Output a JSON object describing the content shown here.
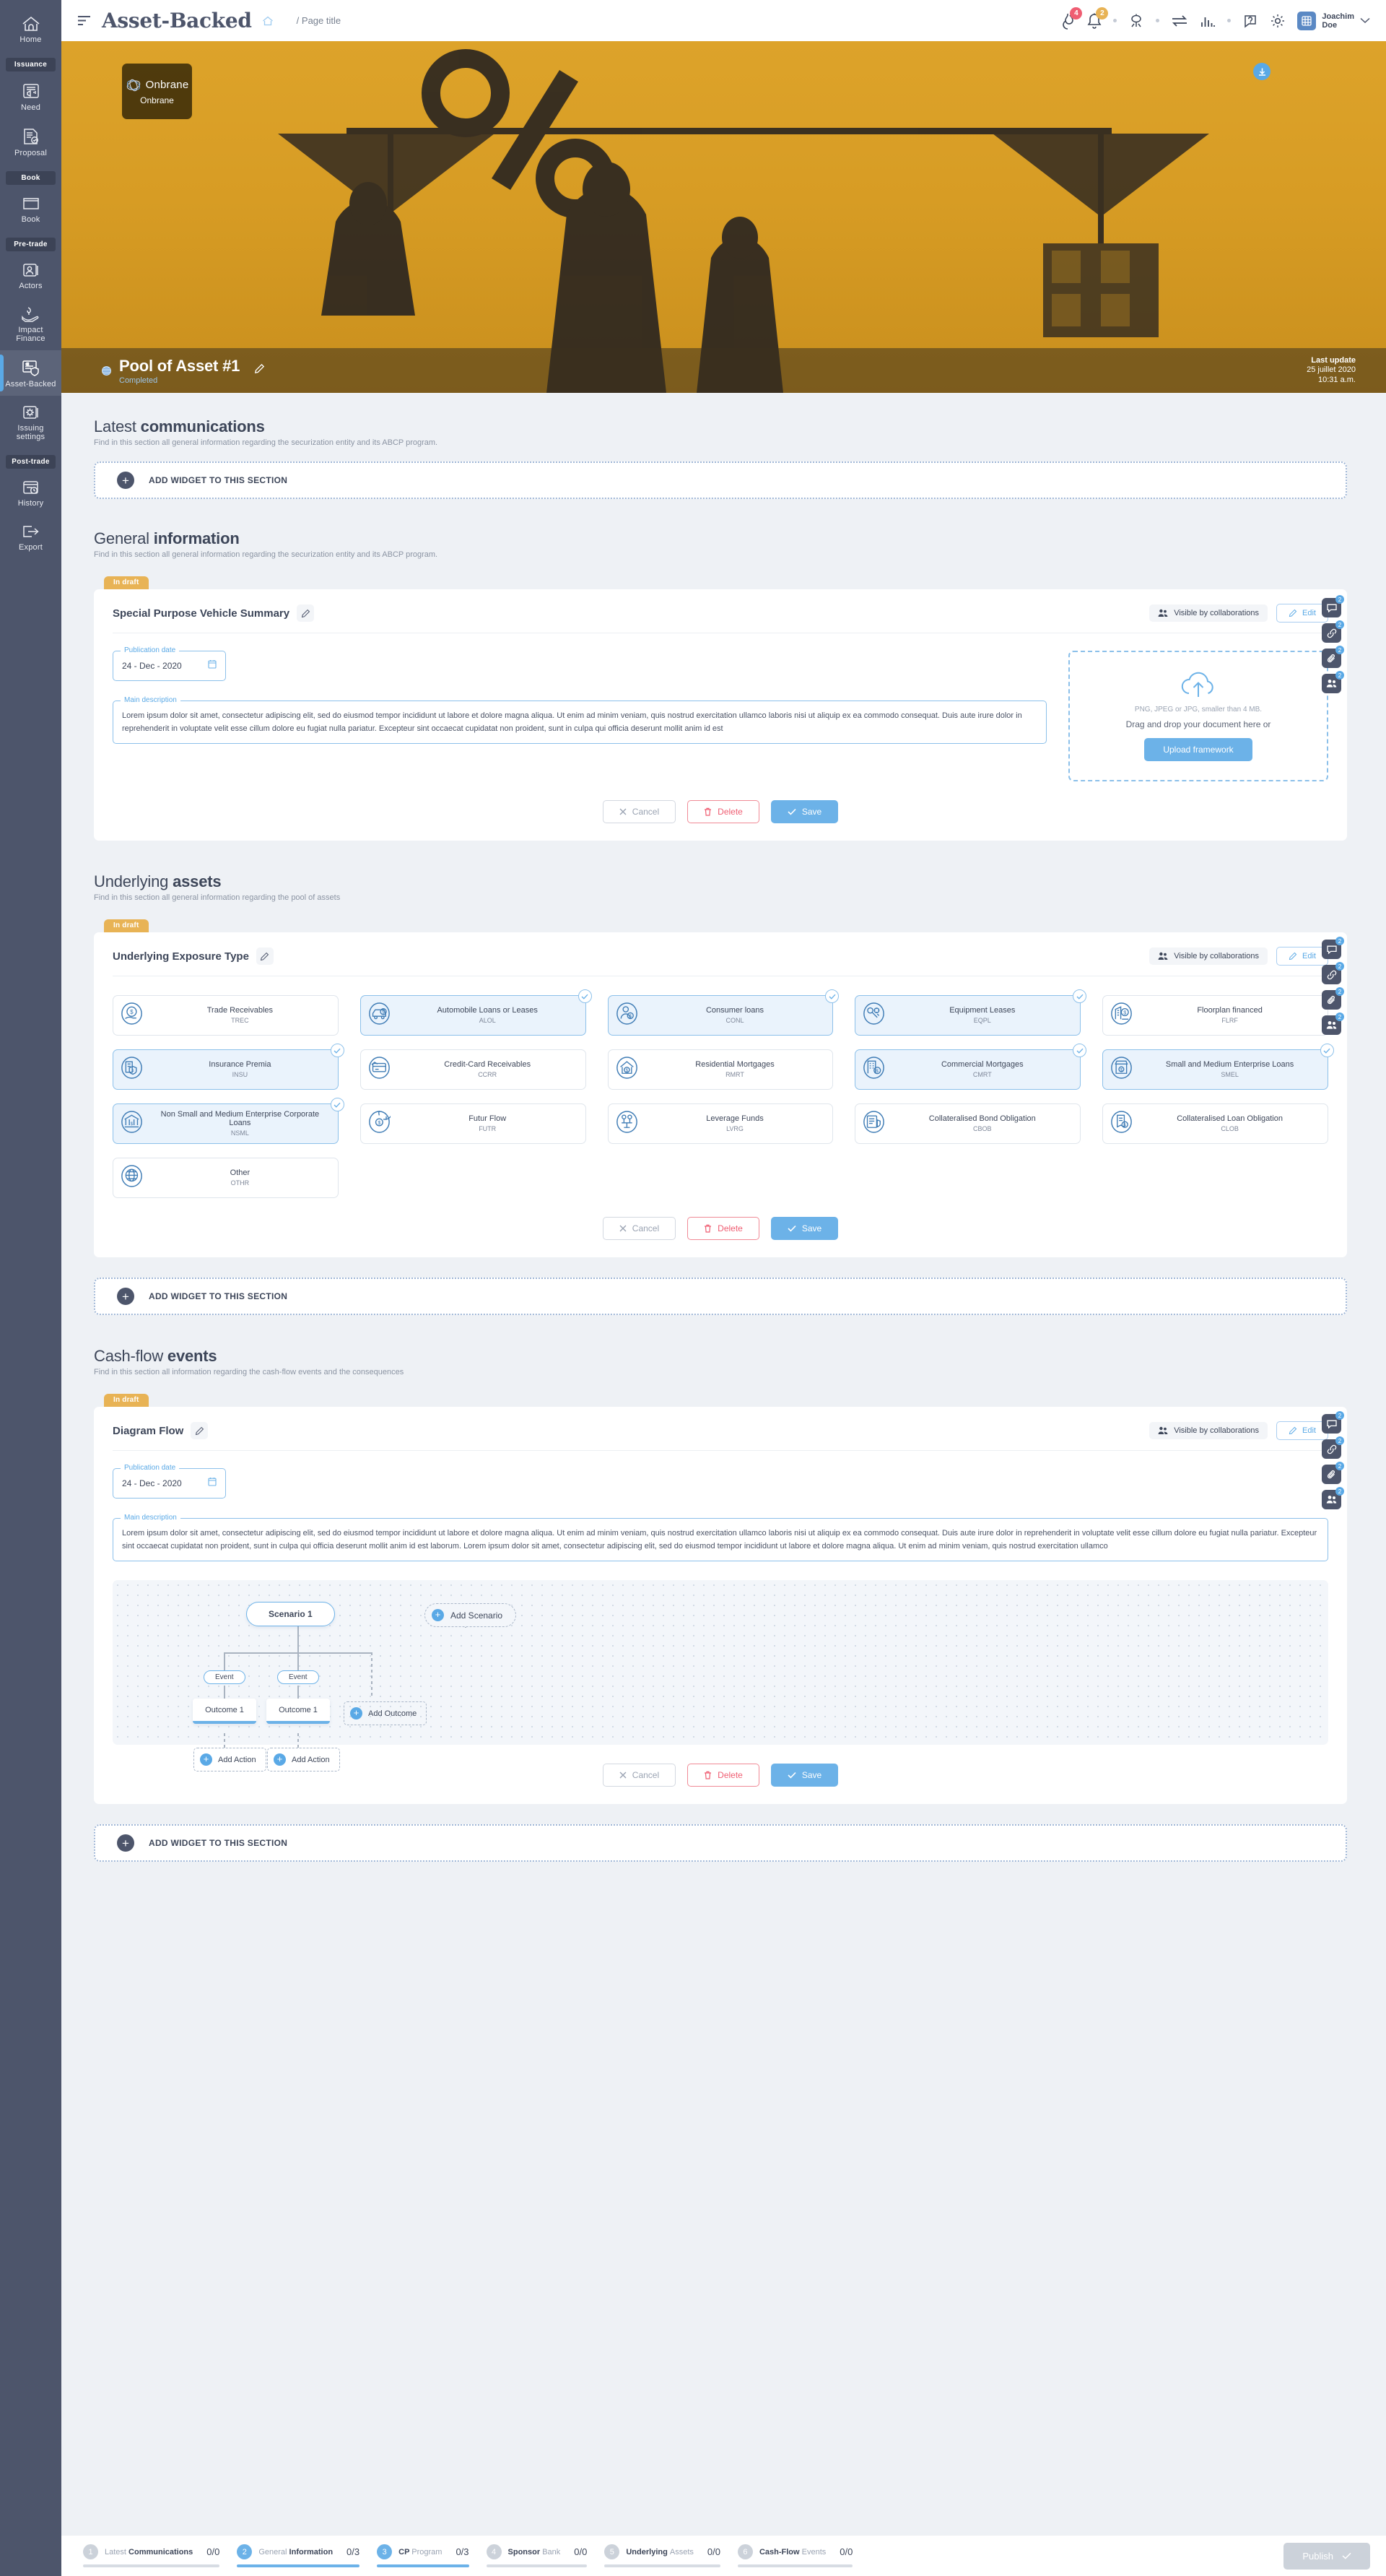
{
  "sidebar": {
    "items": [
      {
        "type": "item",
        "label": "Home",
        "icon": "home-icon",
        "active": false
      },
      {
        "type": "group",
        "label": "Issuance"
      },
      {
        "type": "item",
        "label": "Need",
        "icon": "megaphone-icon",
        "active": false
      },
      {
        "type": "item",
        "label": "Proposal",
        "icon": "document-check-icon",
        "active": false
      },
      {
        "type": "group",
        "label": "Book"
      },
      {
        "type": "item",
        "label": "Book",
        "icon": "book-icon",
        "active": false
      },
      {
        "type": "group",
        "label": "Pre-trade"
      },
      {
        "type": "item",
        "label": "Actors",
        "icon": "actors-icon",
        "active": false
      },
      {
        "type": "item",
        "label": "Impact Finance",
        "icon": "impact-finance-icon",
        "active": false
      },
      {
        "type": "item",
        "label": "Asset-Backed",
        "icon": "asset-backed-icon",
        "active": true
      },
      {
        "type": "item",
        "label": "Issuing settings",
        "icon": "gear-card-icon",
        "active": false
      },
      {
        "type": "group",
        "label": "Post-trade"
      },
      {
        "type": "item",
        "label": "History",
        "icon": "history-icon",
        "active": false
      },
      {
        "type": "item",
        "label": "Export",
        "icon": "export-icon",
        "active": false
      }
    ]
  },
  "topbar": {
    "menu_icon": "hamburger-icon",
    "brand": "Asset-Backed",
    "home_icon": "home-small-icon",
    "breadcrumb": "/ Page title",
    "icons": [
      {
        "name": "fire-icon",
        "badge": "4",
        "badge_color": "red"
      },
      {
        "name": "bell-icon",
        "badge": "2",
        "badge_color": "amber"
      },
      {
        "name": "network-icon",
        "badge": null
      },
      {
        "name": "transfer-icon",
        "badge": null
      },
      {
        "name": "chart-bars-icon",
        "badge": null
      },
      {
        "name": "help-icon",
        "badge": null
      },
      {
        "name": "gear-icon",
        "badge": null
      }
    ],
    "user": {
      "name_line1": "Joachim",
      "name_line2": "Doe",
      "avatar_icon": "user-avatar-icon",
      "chevron": "chevron-down-icon"
    }
  },
  "hero": {
    "logo_card": {
      "title": "Onbrane",
      "subtitle": "Onbrane",
      "logo_icon": "onbrane-orbit-icon"
    },
    "download_icon": "download-icon",
    "pool_title": "Pool of Asset #1",
    "pool_status": "Completed",
    "edit_icon": "pencil-icon",
    "last_update_label": "Last update",
    "last_update_date": "25 juillet 2020",
    "last_update_time": "10:31 a.m."
  },
  "sections": {
    "latest_comm": {
      "title_light": "Latest ",
      "title_bold": "communications",
      "subtitle": "Find in this section all general information regarding the securization entity and its ABCP program.",
      "add_widget_label": "ADD WIDGET TO THIS SECTION"
    },
    "general_info": {
      "title_light": "General ",
      "title_bold": "information",
      "subtitle": "Find in this section all general information regarding the securization entity and its ABCP program."
    },
    "underlying_assets": {
      "title_light": "Underlying ",
      "title_bold": "assets",
      "subtitle": "Find in this section all general information regarding the pool of assets",
      "add_widget_label": "ADD WIDGET TO THIS SECTION"
    },
    "cashflow": {
      "title_light": "Cash-flow ",
      "title_bold": "events",
      "subtitle": "Find in this section all information regarding the cash-flow events and the consequences",
      "add_widget_label": "ADD WIDGET TO THIS SECTION"
    }
  },
  "common": {
    "draft_badge": "In draft",
    "visible_label": "Visible by collaborations",
    "visible_icon": "people-icon",
    "edit_label": "Edit",
    "edit_icon": "pencil-icon",
    "pencil_icon": "pencil-icon",
    "cancel_label": "Cancel",
    "delete_label": "Delete",
    "save_label": "Save",
    "cancel_icon": "close-icon",
    "delete_icon": "trash-icon",
    "save_icon": "check-icon"
  },
  "spv_card": {
    "title": "Special Purpose Vehicle Summary",
    "publication_date_label": "Publication date",
    "publication_date_value": "24 - Dec - 2020",
    "calendar_icon": "calendar-icon",
    "main_description_label": "Main description",
    "main_description_value": "Lorem ipsum dolor sit amet, consectetur adipiscing elit, sed do eiusmod tempor incididunt ut labore et dolore magna aliqua. Ut enim ad minim veniam, quis nostrud exercitation ullamco laboris nisi ut aliquip ex ea commodo consequat. Duis aute irure dolor in reprehenderit in voluptate velit esse cillum dolore eu fugiat nulla pariatur. Excepteur sint occaecat cupidatat non proident, sunt in culpa qui officia deserunt mollit anim id est",
    "upload": {
      "cloud_icon": "cloud-upload-icon",
      "note": "PNG, JPEG or JPG, smaller than 4 MB.",
      "drag_text": "Drag and drop your document here or",
      "button_label": "Upload framework"
    }
  },
  "exposure_card": {
    "title": "Underlying Exposure Type",
    "chips": [
      {
        "name": "Trade Receivables",
        "code": "TREC",
        "icon": "hand-dollar-icon",
        "selected": false
      },
      {
        "name": "Automobile Loans or Leases",
        "code": "ALOL",
        "icon": "car-dollar-icon",
        "selected": true
      },
      {
        "name": "Consumer loans",
        "code": "CONL",
        "icon": "person-dollar-icon",
        "selected": true
      },
      {
        "name": "Equipment Leases",
        "code": "EQPL",
        "icon": "keys-gear-icon",
        "selected": true
      },
      {
        "name": "Floorplan financed",
        "code": "FLRF",
        "icon": "building-dollar-icon",
        "selected": false
      },
      {
        "name": "Insurance Premia",
        "code": "INSU",
        "icon": "shield-dollar-icon",
        "selected": true
      },
      {
        "name": "Credit-Card Receivables",
        "code": "CCRR",
        "icon": "credit-card-icon",
        "selected": false
      },
      {
        "name": "Residential Mortgages",
        "code": "RMRT",
        "icon": "house-dollar-icon",
        "selected": false
      },
      {
        "name": "Commercial Mortgages",
        "code": "CMRT",
        "icon": "office-dollar-icon",
        "selected": true
      },
      {
        "name": "Small and Medium Enterprise Loans",
        "code": "SMEL",
        "icon": "shop-dollar-icon",
        "selected": true
      },
      {
        "name": "Non Small and Medium Enterprise Corporate Loans",
        "code": "NSML",
        "icon": "bank-dollar-icon",
        "selected": true
      },
      {
        "name": "Futur Flow",
        "code": "FUTR",
        "icon": "cycle-dollar-icon",
        "selected": false
      },
      {
        "name": "Leverage Funds",
        "code": "LVRG",
        "icon": "balance-dollar-icon",
        "selected": false
      },
      {
        "name": "Collateralised Bond Obligation",
        "code": "CBOB",
        "icon": "bond-icon",
        "selected": false
      },
      {
        "name": "Collateralised Loan Obligation",
        "code": "CLOB",
        "icon": "loan-icon",
        "selected": false
      },
      {
        "name": "Other",
        "code": "OTHR",
        "icon": "globe-icon",
        "selected": false
      }
    ]
  },
  "diagram_card": {
    "title": "Diagram Flow",
    "publication_date_label": "Publication date",
    "publication_date_value": "24 - Dec - 2020",
    "main_description_label": "Main description",
    "main_description_value": "Lorem ipsum dolor sit amet, consectetur adipiscing elit, sed do eiusmod tempor incididunt ut labore et dolore magna aliqua. Ut enim ad minim veniam, quis nostrud exercitation ullamco laboris nisi ut aliquip ex ea commodo consequat. Duis aute irure dolor in reprehenderit in voluptate velit esse cillum dolore eu fugiat nulla pariatur. Excepteur sint occaecat cupidatat non proident, sunt in culpa qui officia deserunt mollit anim id est laborum. Lorem ipsum dolor sit amet, consectetur adipiscing elit, sed do eiusmod tempor incididunt ut labore et dolore magna aliqua. Ut enim ad minim veniam, quis nostrud exercitation ullamco",
    "flow": {
      "scenario_label": "Scenario 1",
      "add_scenario_label": "Add Scenario",
      "event_label_1": "Event",
      "event_label_2": "Event",
      "outcome_label_1": "Outcome 1",
      "outcome_label_2": "Outcome 1",
      "add_outcome_label": "Add Outcome",
      "add_action_label_1": "Add Action",
      "add_action_label_2": "Add Action"
    }
  },
  "fabs": [
    {
      "name": "comment-fab",
      "icon": "comment-icon",
      "count": "2"
    },
    {
      "name": "link-fab",
      "icon": "link-icon",
      "count": "2"
    },
    {
      "name": "attach-fab",
      "icon": "attach-icon",
      "count": "2"
    },
    {
      "name": "users-fab",
      "icon": "users-icon",
      "count": "2"
    }
  ],
  "bottombar": {
    "steps": [
      {
        "num": "1",
        "label_bold": "Communications",
        "label_light": "Latest ",
        "count": "0/0",
        "active": false
      },
      {
        "num": "2",
        "label_bold": "Information",
        "label_light": "General ",
        "count": "0/3",
        "active": true
      },
      {
        "num": "3",
        "label_bold": "CP ",
        "label_light": "Program",
        "count": "0/3",
        "active": true,
        "bold_first": true
      },
      {
        "num": "4",
        "label_bold": "Sponsor ",
        "label_light": "Bank",
        "count": "0/0",
        "active": false,
        "bold_first": true
      },
      {
        "num": "5",
        "label_bold": "Underlying ",
        "label_light": "Assets",
        "count": "0/0",
        "active": false,
        "bold_first": true
      },
      {
        "num": "6",
        "label_bold": "Cash-Flow ",
        "label_light": "Events",
        "count": "0/0",
        "active": false,
        "bold_first": true
      }
    ],
    "publish_label": "Publish",
    "publish_icon": "check-icon"
  },
  "colors": {
    "accent_blue": "#6cb2e8",
    "sidebar": "#4d556b",
    "hero_gold": "#d79c24",
    "danger": "#ef5d72",
    "draft_amber": "#e8b355"
  }
}
